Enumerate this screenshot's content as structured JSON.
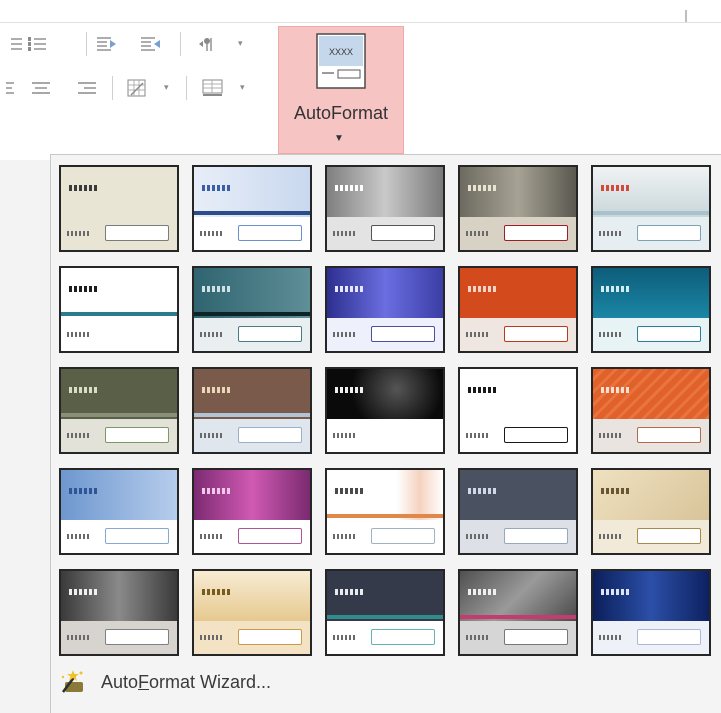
{
  "ribbon": {
    "autoformat_label": "AutoFormat",
    "autoformat_icon_text": "XXXX"
  },
  "gallery": {
    "thumb_text": "xxxxx",
    "themes": [
      {
        "hdr": "#e9e5d5",
        "ftr": "#e9e5d5",
        "xx": "#3b3b3b",
        "box": "#7b7b7b",
        "bar": ""
      },
      {
        "hdr": "linear-gradient(90deg,#e8eef8,#c8d8ee)",
        "ftr": "#ffffff",
        "xx": "#3b5ea8",
        "box": "#6b8fc9",
        "bar": "#2d4d8a"
      },
      {
        "hdr": "linear-gradient(90deg,#7f7f7f,#c9c9c9,#7a7a7a)",
        "ftr": "#e3e3e3",
        "xx": "#ffffff",
        "box": "#555555",
        "bar": ""
      },
      {
        "hdr": "linear-gradient(90deg,#6d6a5f,#a6a294,#5a584f)",
        "ftr": "#d8d2c4",
        "xx": "#e8e3d3",
        "box": "#a01d25",
        "bar": ""
      },
      {
        "hdr": "linear-gradient(180deg,#f0f3f4,#c9d6da)",
        "ftr": "#e7eef1",
        "xx": "#d44a3a",
        "box": "#7aa3b6",
        "bar": "#a8c2cb"
      },
      {
        "hdr": "#ffffff",
        "ftr": "#ffffff",
        "xx": "#1e1e1e",
        "box": "#ffffff",
        "bar": "#2a7b8c"
      },
      {
        "hdr": "linear-gradient(90deg,#2f6470,#5f8f97)",
        "ftr": "#e9eef0",
        "xx": "#cfe2e5",
        "box": "#4a7b86",
        "bar": "#0c2328"
      },
      {
        "hdr": "linear-gradient(90deg,#2d2f8f,#6a6ee0,#3b3ea6)",
        "ftr": "#eef0fb",
        "xx": "#e6e6ff",
        "box": "#4a4f9f",
        "bar": ""
      },
      {
        "hdr": "#d34a1c",
        "ftr": "#efe6e2",
        "xx": "#f6d3c5",
        "box": "#b73a1a",
        "bar": ""
      },
      {
        "hdr": "linear-gradient(180deg,#0d5d7a,#1b86a6)",
        "ftr": "#e8f3f6",
        "xx": "#d2edf4",
        "box": "#2b7f9b",
        "bar": ""
      },
      {
        "hdr": "#5a6048",
        "ftr": "#e2e2d8",
        "xx": "#d8dcc8",
        "box": "#7b9a63",
        "bar": "#88907a"
      },
      {
        "hdr": "#7a5a4a",
        "ftr": "#dfe6ee",
        "xx": "#e9d7b7",
        "box": "#9bb0c6",
        "bar": "#b0c4d6"
      },
      {
        "hdr": "radial-gradient(circle at 60% 40%,#555,#0a0a0a 60%)",
        "ftr": "#ffffff",
        "xx": "#f0f0f0",
        "box": "#ffffff",
        "bar": ""
      },
      {
        "hdr": "#ffffff",
        "ftr": "#ffffff",
        "xx": "#1a1a1a",
        "box": "#1a1a1a",
        "bar": ""
      },
      {
        "hdr": "repeating-linear-gradient(135deg,#e0612a 0 6px,#ea7440 6px 9px)",
        "ftr": "#e9e4df",
        "xx": "#fbe0d2",
        "box": "#b36a4a",
        "bar": ""
      },
      {
        "hdr": "linear-gradient(90deg,#6e97cf,#b6cdec)",
        "ftr": "#ffffff",
        "xx": "#2f5596",
        "box": "#86a8d5",
        "bar": ""
      },
      {
        "hdr": "linear-gradient(90deg,#7d2a72,#d05ab3,#7a2a70)",
        "ftr": "#ffffff",
        "xx": "#f1c8ea",
        "box": "#a85898",
        "bar": ""
      },
      {
        "hdr": "linear-gradient(90deg,#ffffff 60%,#f6d2c0 80%,#ffffff)",
        "ftr": "#ffffff",
        "xx": "#4a4a4a",
        "box": "#9fb3c4",
        "bar": "#e0874a"
      },
      {
        "hdr": "#4a5160",
        "ftr": "#dde0e6",
        "xx": "#d2d9e6",
        "box": "#9aa6ba",
        "bar": ""
      },
      {
        "hdr": "linear-gradient(135deg,#efe1c0,#d8c49a)",
        "ftr": "#f2ead8",
        "xx": "#6a5630",
        "box": "#a8894a",
        "bar": ""
      },
      {
        "hdr": "linear-gradient(90deg,#3a3a3a,#8a8a8a,#3a3a3a)",
        "ftr": "#d7d4cf",
        "xx": "#f0f0f0",
        "box": "#808080",
        "bar": ""
      },
      {
        "hdr": "linear-gradient(180deg,#f7ecd3,#e6c98f)",
        "ftr": "#f3e3c4",
        "xx": "#7a5a1f",
        "box": "#c89a4a",
        "bar": ""
      },
      {
        "hdr": "#343a4a",
        "ftr": "#ffffff",
        "xx": "#e8eaf0",
        "box": "#63b5b2",
        "bar": "#2f8e8c"
      },
      {
        "hdr": "linear-gradient(135deg,#505050,#9a9a9a,#4a4a4a)",
        "ftr": "#d6d6d6",
        "xx": "#f0f0f0",
        "box": "#777777",
        "bar": "#c43b6e"
      },
      {
        "hdr": "linear-gradient(90deg,#0b1f5a,#2c4fa8,#0d2160)",
        "ftr": "#eef1f8",
        "xx": "#dde6ff",
        "box": "#aab9da",
        "bar": ""
      }
    ]
  },
  "menu": {
    "wizard_label_pre": "Auto",
    "wizard_label_accel": "F",
    "wizard_label_post": "ormat Wizard..."
  }
}
